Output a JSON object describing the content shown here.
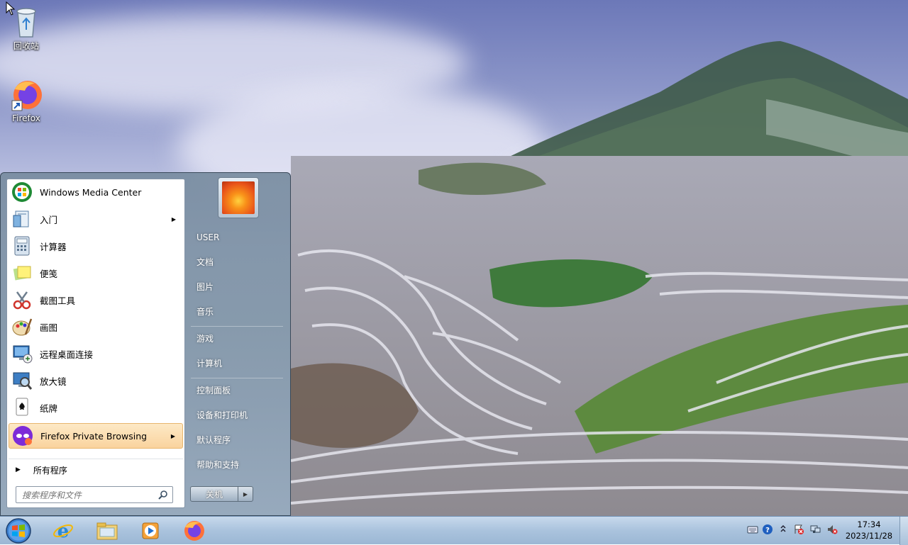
{
  "desktop": {
    "icons": [
      {
        "label": "回收站",
        "icon": "recycle-bin-icon"
      },
      {
        "label": "Firefox",
        "icon": "firefox-icon"
      }
    ]
  },
  "start_menu": {
    "programs": [
      {
        "label": "Windows Media Center",
        "icon": "windows-media-center-icon",
        "submenu": false
      },
      {
        "label": "入门",
        "icon": "getting-started-icon",
        "submenu": true
      },
      {
        "label": "计算器",
        "icon": "calculator-icon",
        "submenu": false
      },
      {
        "label": "便笺",
        "icon": "sticky-notes-icon",
        "submenu": false
      },
      {
        "label": "截图工具",
        "icon": "snipping-tool-icon",
        "submenu": false
      },
      {
        "label": "画图",
        "icon": "paint-icon",
        "submenu": false
      },
      {
        "label": "远程桌面连接",
        "icon": "remote-desktop-icon",
        "submenu": false
      },
      {
        "label": "放大镜",
        "icon": "magnifier-icon",
        "submenu": false
      },
      {
        "label": "纸牌",
        "icon": "solitaire-icon",
        "submenu": false
      },
      {
        "label": "Firefox Private Browsing",
        "icon": "firefox-private-browsing-icon",
        "submenu": true,
        "highlighted": true
      }
    ],
    "all_programs_label": "所有程序",
    "search": {
      "placeholder": "搜索程序和文件"
    },
    "right_links": [
      {
        "label": "USER"
      },
      {
        "label": "文档"
      },
      {
        "label": "图片"
      },
      {
        "label": "音乐"
      },
      {
        "label": "游戏"
      },
      {
        "label": "计算机"
      },
      {
        "label": "控制面板"
      },
      {
        "label": "设备和打印机"
      },
      {
        "label": "默认程序"
      },
      {
        "label": "帮助和支持"
      }
    ],
    "shutdown_label": "关机"
  },
  "taskbar": {
    "pinned": [
      {
        "icon": "internet-explorer-icon"
      },
      {
        "icon": "file-explorer-icon"
      },
      {
        "icon": "media-player-icon"
      },
      {
        "icon": "firefox-icon"
      }
    ],
    "tray_icons": [
      "keyboard-icon",
      "help-icon",
      "show-hidden-icons-icon",
      "action-center-icon",
      "network-icon",
      "volume-muted-icon"
    ],
    "clock": {
      "time": "17:34",
      "date": "2023/11/28"
    }
  },
  "colors": {
    "taskbar": "#aac3dd",
    "start_menu_frame": "#7f95ab",
    "highlight": "#fad39e"
  }
}
